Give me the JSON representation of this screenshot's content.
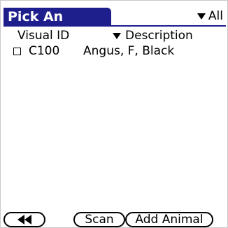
{
  "title": "Pick An Animal",
  "filter": {
    "label": "All",
    "icon": "dropdown-triangle-icon"
  },
  "columns": {
    "visual_id": "Visual ID",
    "description": "Description"
  },
  "rows": [
    {
      "checked": false,
      "visual_id": "C100",
      "description": "Angus, F, Black"
    }
  ],
  "buttons": {
    "back_icon": "rewind-icon",
    "scan": "Scan",
    "add_animal": "Add Animal"
  }
}
